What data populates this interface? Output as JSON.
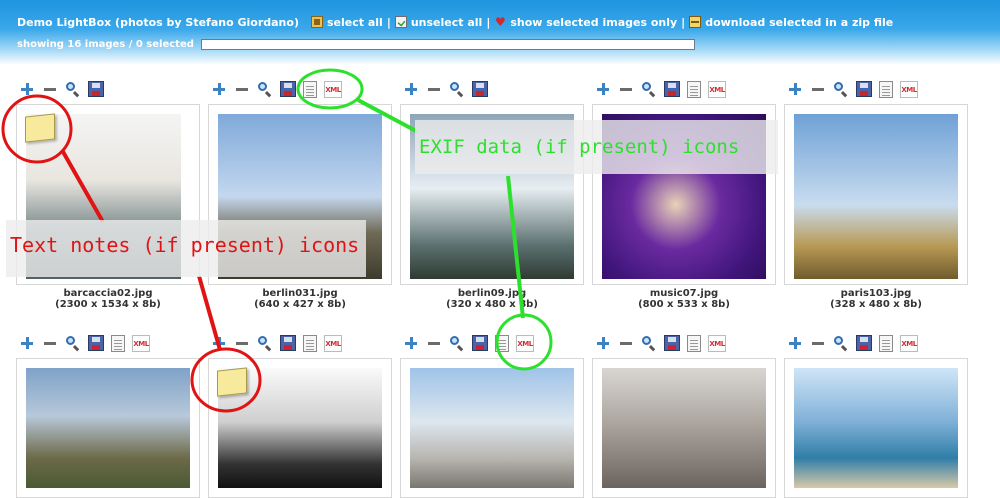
{
  "header": {
    "app_title": "Demo LightBox (photos by Stefano Giordano)",
    "separator": "|",
    "links": [
      {
        "label": "select all",
        "icon": "select-all-icon"
      },
      {
        "label": "unselect all",
        "icon": "unselect-all-icon"
      },
      {
        "label": "show selected images only",
        "icon": "heart-icon"
      },
      {
        "label": "download selected in a zip file",
        "icon": "zip-file-icon"
      }
    ],
    "status": "showing 16 images / 0 selected",
    "progress_fraction": 0
  },
  "toolbar_icons": {
    "plus": "plus-icon",
    "minus": "minus-icon",
    "zoom": "magnifier-icon",
    "save": "floppy-disk-icon",
    "note": "text-note-icon",
    "xml": "XML"
  },
  "images": [
    {
      "filename": "barcaccia02.jpg",
      "info": "(2300 x 1534 x 8b)",
      "has_note": true,
      "has_exif": false
    },
    {
      "filename": "berlin031.jpg",
      "info": "(640 x 427 x 8b)",
      "has_note": false,
      "has_exif": true
    },
    {
      "filename": "berlin09.jpg",
      "info": "(320 x 480 x 8b)",
      "has_note": false,
      "has_exif": false
    },
    {
      "filename": "music07.jpg",
      "info": "(800 x 533 x 8b)",
      "has_note": false,
      "has_exif": true
    },
    {
      "filename": "paris103.jpg",
      "info": "(328 x 480 x 8b)",
      "has_note": false,
      "has_exif": true
    },
    {
      "filename": "",
      "info": "",
      "has_note": false,
      "has_exif": true
    },
    {
      "filename": "",
      "info": "",
      "has_note": true,
      "has_exif": true
    },
    {
      "filename": "",
      "info": "",
      "has_note": false,
      "has_exif": true
    },
    {
      "filename": "",
      "info": "",
      "has_note": false,
      "has_exif": true
    },
    {
      "filename": "",
      "info": "",
      "has_note": false,
      "has_exif": true
    }
  ],
  "annotations": {
    "exif_label": "EXIF data (if present) icons",
    "exif_color": "#2ee02e",
    "notes_label": "Text notes (if present) icons",
    "notes_color": "#e01414"
  },
  "colors": {
    "header_top": "#1e95df",
    "header_bottom": "#a9dbf7",
    "progress_fill": "#2f7ec8"
  }
}
